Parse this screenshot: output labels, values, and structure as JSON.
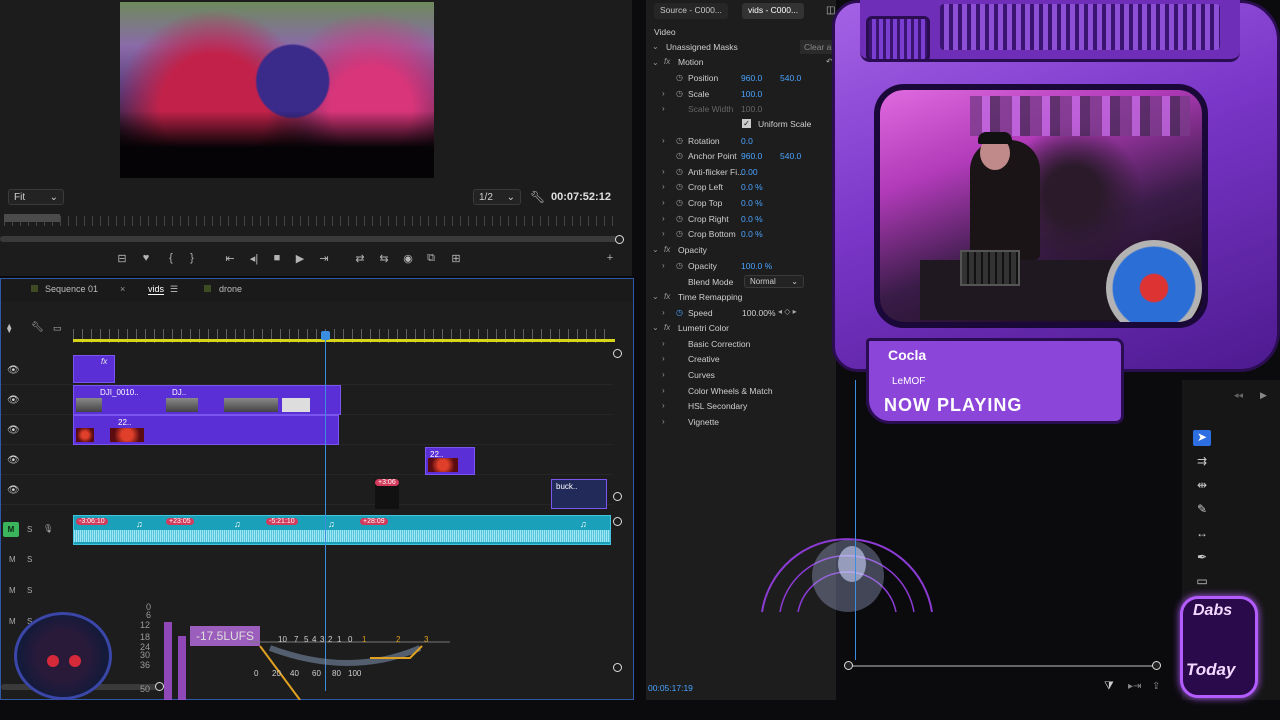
{
  "program_monitor": {
    "fit_select": "Fit",
    "resolution_select": "1/2",
    "timecode": "00:07:52:12"
  },
  "timeline": {
    "tabs": [
      {
        "label": "Sequence 01"
      },
      {
        "label": "vids"
      },
      {
        "label": "drone"
      }
    ],
    "clips": {
      "v1_fx": "fx",
      "v2_a": "DJI_0010..",
      "v2_b": "DJ..",
      "v3_a": "22..",
      "v4_a": "22..",
      "v6_a": "buck.."
    },
    "clip_badge": "+3:06",
    "audio_markers": [
      "-3:06:10",
      "+23:05",
      "-5:21:10",
      "+28:09"
    ],
    "track_labels": [
      "M",
      "S",
      "M",
      "S",
      "M",
      "S",
      "M",
      "S"
    ]
  },
  "effect_controls": {
    "tabs": [
      "Source - C000...",
      "vids - C000..."
    ],
    "section_video": "Video",
    "unassigned_masks": "Unassigned Masks",
    "clear_all": "Clear all",
    "motion": "Motion",
    "position_label": "Position",
    "position_x": "960.0",
    "position_y": "540.0",
    "scale_label": "Scale",
    "scale_value": "100.0",
    "scale_width_label": "Scale Width",
    "scale_width_value": "100.0",
    "uniform_scale": "Uniform Scale",
    "rotation_label": "Rotation",
    "rotation_value": "0.0",
    "anchor_label": "Anchor Point",
    "anchor_x": "960.0",
    "anchor_y": "540.0",
    "antiflicker_label": "Anti-flicker Fi...",
    "antiflicker_value": "0.00",
    "crop_left_label": "Crop Left",
    "crop_left_value": "0.0 %",
    "crop_top_label": "Crop Top",
    "crop_top_value": "0.0 %",
    "crop_right_label": "Crop Right",
    "crop_right_value": "0.0 %",
    "crop_bottom_label": "Crop Bottom",
    "crop_bottom_value": "0.0 %",
    "opacity_section": "Opacity",
    "opacity_label": "Opacity",
    "opacity_value": "100.0 %",
    "blend_mode_label": "Blend Mode",
    "blend_mode_value": "Normal",
    "time_remap": "Time Remapping",
    "speed_label": "Speed",
    "speed_value": "100.00%",
    "lumetri": "Lumetri Color",
    "lumetri_items": [
      "Basic Correction",
      "Creative",
      "Curves",
      "Color Wheels & Match",
      "HSL Secondary",
      "Vignette"
    ],
    "timecode": "00:05:17:19"
  },
  "stream_overlay": {
    "artist": "Cocla",
    "track": "LeMOF",
    "label": "NOW PLAYING",
    "logo_top": "Dabs",
    "logo_bottom": "Today"
  },
  "loudness": {
    "readout": "-17.5LUFS",
    "db_labels": [
      "0",
      "6",
      "12",
      "18",
      "24",
      "30",
      "36",
      "50"
    ],
    "scale_top": [
      "10",
      "7",
      "5",
      "4",
      "3",
      "2",
      "1",
      "0",
      "1",
      "2",
      "3"
    ],
    "scale_bottom": [
      "0",
      "20",
      "40",
      "60",
      "80",
      "100"
    ]
  },
  "colors": {
    "clip_video": "#5a2fd6",
    "clip_audio": "#1aa0b8",
    "playhead": "#3b8de0",
    "value_blue": "#4aa3ff",
    "overlay_purple": "#8b45d8"
  }
}
